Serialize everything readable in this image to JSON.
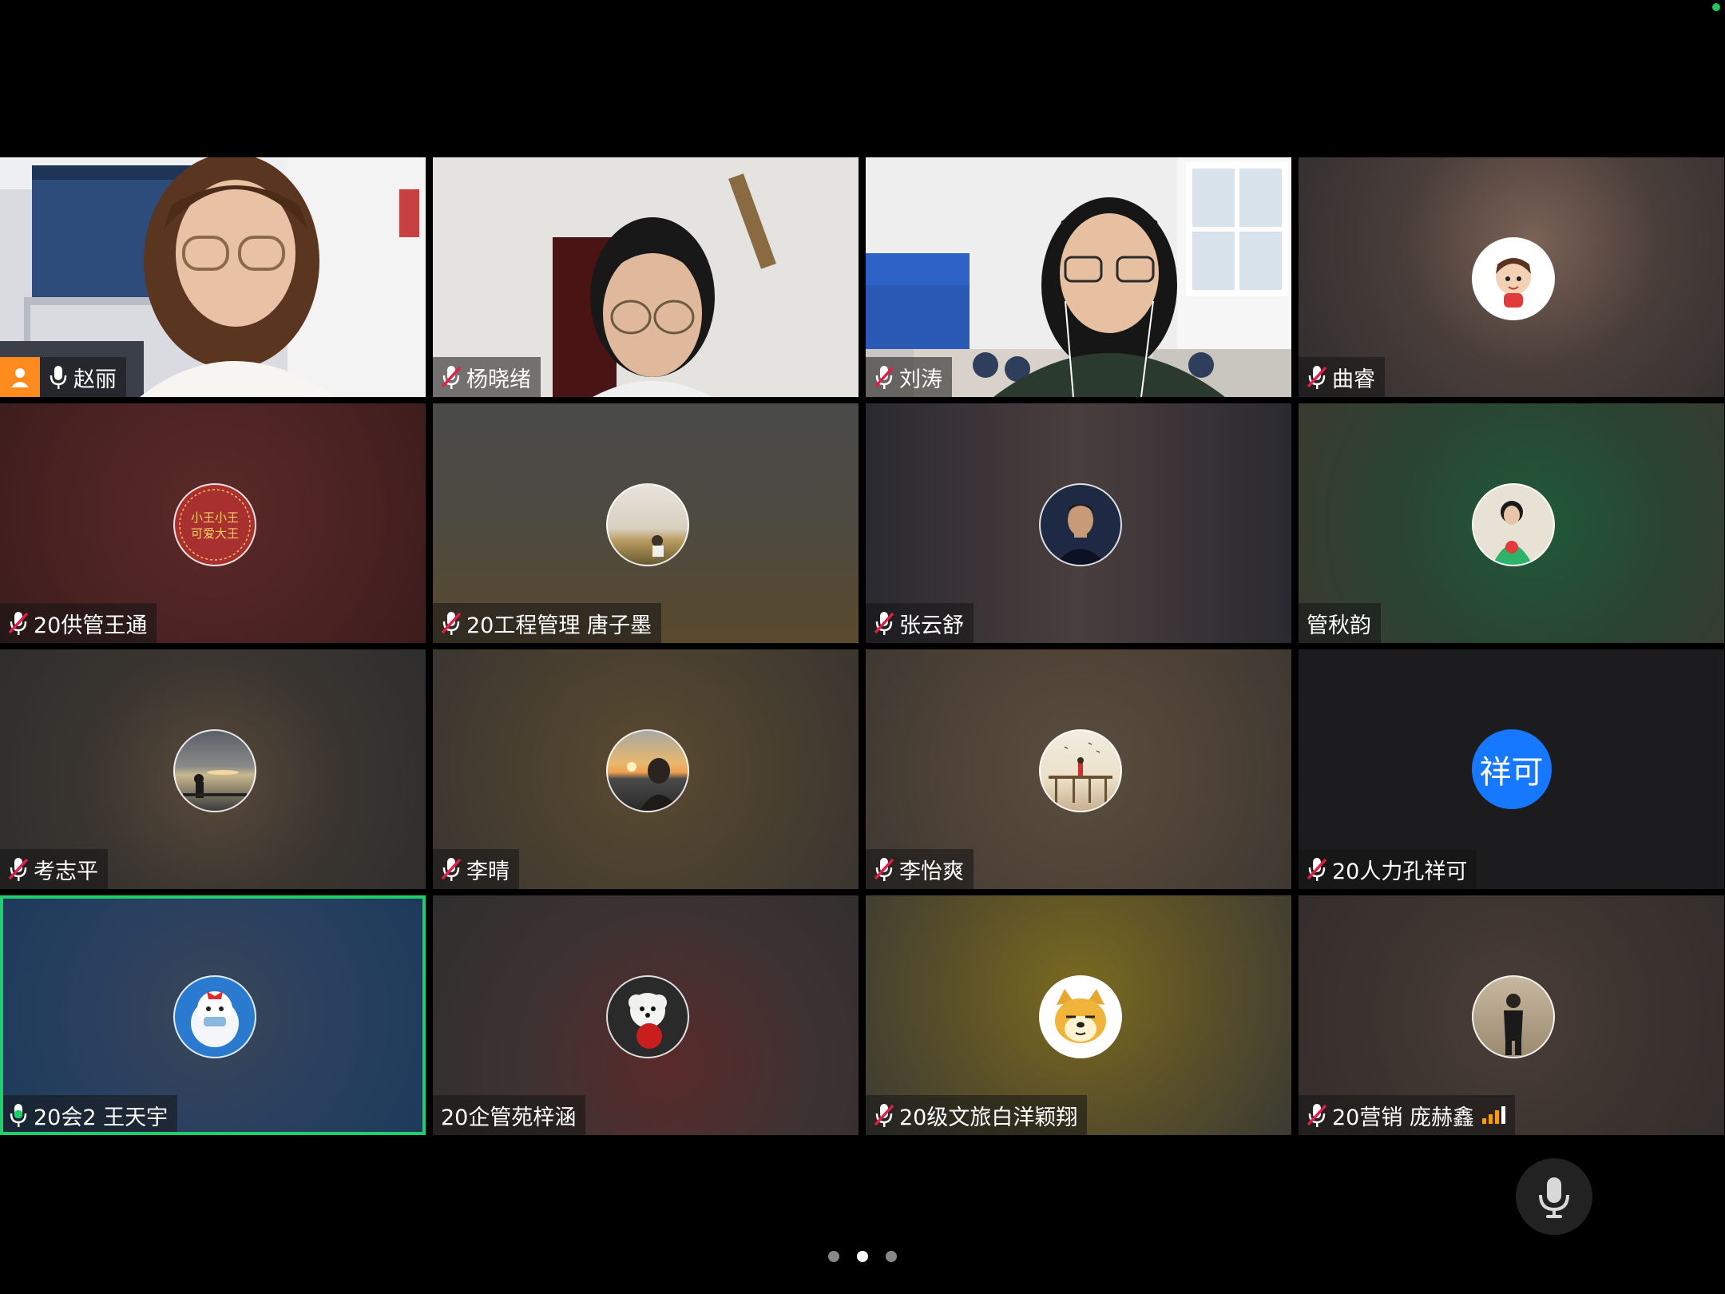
{
  "colors": {
    "background": "#000000",
    "host_badge": "#ff8a1e",
    "active_border": "#1fcf6b",
    "muted_mic": "#e11d48",
    "text_avatar": "#1677ff"
  },
  "participants": [
    {
      "name": "赵丽",
      "host": true,
      "mic": "unmuted",
      "video": true
    },
    {
      "name": "杨晓绪",
      "mic": "muted",
      "video": true
    },
    {
      "name": "刘涛",
      "mic": "muted",
      "video": true
    },
    {
      "name": "曲睿",
      "mic": "muted",
      "video": false,
      "avatar_icon": "cartoon-avatar-icon"
    },
    {
      "name": "20供管王通",
      "mic": "muted",
      "video": false,
      "avatar_icon": "red-seal-avatar-icon",
      "avatar_text": "小王小王\n可爱大王"
    },
    {
      "name": "20工程管理 唐子墨",
      "mic": "muted",
      "video": false,
      "avatar_icon": "landscape-avatar-icon"
    },
    {
      "name": "张云舒",
      "mic": "muted",
      "video": false,
      "avatar_icon": "photo-avatar-icon"
    },
    {
      "name": "管秋韵",
      "mic": "none",
      "video": false,
      "avatar_icon": "photo-avatar-icon"
    },
    {
      "name": "考志平",
      "mic": "muted",
      "video": false,
      "avatar_icon": "sunset-avatar-icon"
    },
    {
      "name": "李晴",
      "mic": "muted",
      "video": false,
      "avatar_icon": "sunset-avatar-icon"
    },
    {
      "name": "李怡爽",
      "mic": "muted",
      "video": false,
      "avatar_icon": "pier-avatar-icon"
    },
    {
      "name": "20人力孔祥可",
      "mic": "muted",
      "video": false,
      "avatar_text": "祥可"
    },
    {
      "name": "20会2 王天宇",
      "mic": "speaking",
      "video": false,
      "active": true,
      "avatar_icon": "snowman-avatar-icon"
    },
    {
      "name": "20企管苑梓涵",
      "mic": "none",
      "video": false,
      "avatar_icon": "dog-avatar-icon"
    },
    {
      "name": "20级文旅白洋颖翔",
      "mic": "muted",
      "video": false,
      "avatar_icon": "doge-avatar-icon"
    },
    {
      "name": "20营销 庞赫鑫",
      "mic": "muted",
      "video": false,
      "avatar_icon": "photo-avatar-icon",
      "signal_icon": "signal-bars-icon"
    }
  ],
  "controls": {
    "mic_icon": "microphone-icon"
  },
  "pagination": {
    "pages": 3,
    "current": 2
  }
}
